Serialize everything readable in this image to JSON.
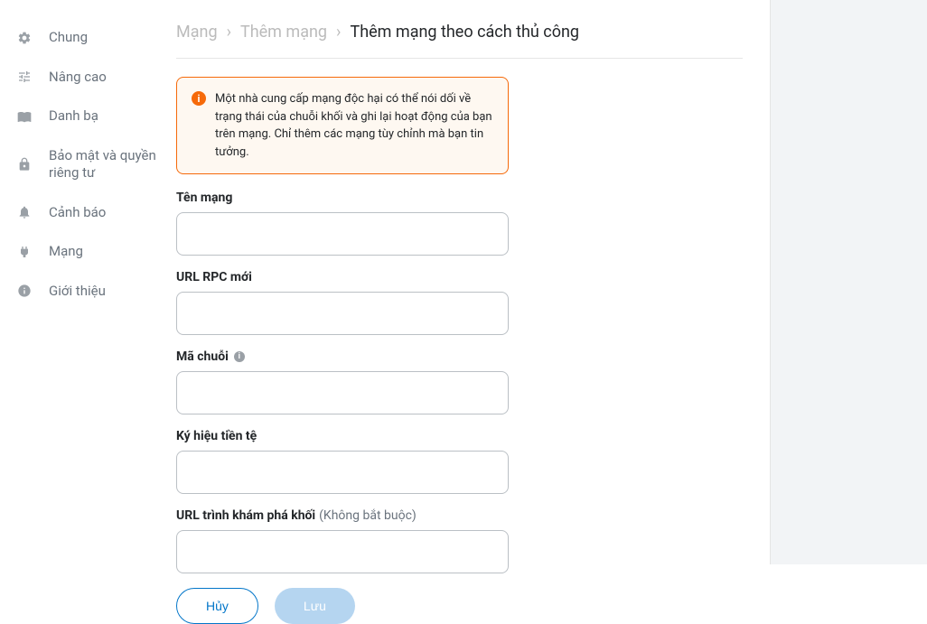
{
  "sidebar": {
    "items": [
      {
        "label": "Chung",
        "icon": "gear"
      },
      {
        "label": "Nâng cao",
        "icon": "sliders"
      },
      {
        "label": "Danh bạ",
        "icon": "contacts"
      },
      {
        "label": "Bảo mật và quyền riêng tư",
        "icon": "lock"
      },
      {
        "label": "Cảnh báo",
        "icon": "bell"
      },
      {
        "label": "Mạng",
        "icon": "plug"
      },
      {
        "label": "Giới thiệu",
        "icon": "info"
      }
    ]
  },
  "breadcrumb": {
    "root": "Mạng",
    "mid": "Thêm mạng",
    "current": "Thêm mạng theo cách thủ công"
  },
  "warning": {
    "text": "Một nhà cung cấp mạng độc hại có thể nói dối về trạng thái của chuỗi khối và ghi lại hoạt động của bạn trên mạng. Chỉ thêm các mạng tùy chỉnh mà bạn tin tưởng."
  },
  "form": {
    "networkName": {
      "label": "Tên mạng",
      "value": ""
    },
    "rpcUrl": {
      "label": "URL RPC mới",
      "value": ""
    },
    "chainId": {
      "label": "Mã chuỗi",
      "value": ""
    },
    "currencySymbol": {
      "label": "Ký hiệu tiền tệ",
      "value": ""
    },
    "explorerUrl": {
      "label": "URL trình khám phá khối",
      "optional": "(Không bắt buộc)",
      "value": ""
    }
  },
  "buttons": {
    "cancel": "Hủy",
    "save": "Lưu"
  }
}
